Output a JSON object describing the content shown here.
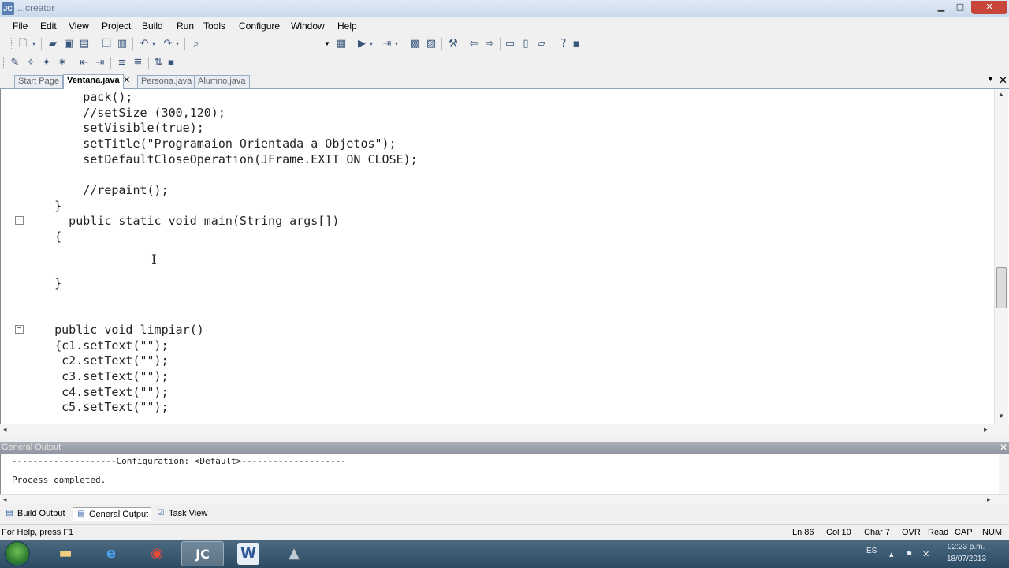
{
  "window": {
    "title": "...creator"
  },
  "menu": [
    "File",
    "Edit",
    "View",
    "Project",
    "Build",
    "Run",
    "Tools",
    "Configure",
    "Window",
    "Help"
  ],
  "editor_tabs": [
    {
      "label": "Start Page",
      "active": false
    },
    {
      "label": "Ventana.java",
      "active": true
    },
    {
      "label": "Persona.java",
      "active": false
    },
    {
      "label": "Alumno.java",
      "active": false
    }
  ],
  "code_lines": [
    "        pack();",
    "        //setSize (300,120);",
    "        setVisible(true);",
    "        setTitle(\"Programaion Orientada a Objetos\");",
    "        setDefaultCloseOperation(JFrame.EXIT_ON_CLOSE);",
    "",
    "        //repaint();",
    "    }",
    "      public static void main(String args[])",
    "    {",
    "",
    "",
    "    }",
    "",
    "",
    "    public void limpiar()",
    "    {c1.setText(\"\");",
    "     c2.setText(\"\");",
    "     c3.setText(\"\");",
    "     c4.setText(\"\");",
    "     c5.setText(\"\");"
  ],
  "output_panel": {
    "title": "General Output",
    "lines": [
      "--------------------Configuration: <Default>--------------------",
      "",
      "Process completed."
    ]
  },
  "bottom_tabs": [
    {
      "label": "Build Output",
      "active": false
    },
    {
      "label": "General Output",
      "active": true
    },
    {
      "label": "Task View",
      "active": false
    }
  ],
  "status": {
    "help": "For Help, press F1",
    "ln": "Ln 86",
    "col": "Col 10",
    "char": "Char 7",
    "ovr": "OVR",
    "read": "Read",
    "cap": "CAP",
    "num": "NUM"
  },
  "taskbar": {
    "lang": "ES",
    "time": "02:23 p.m.",
    "date": "18/07/2013",
    "apps": [
      "explorer",
      "internet-explorer",
      "chrome",
      "jcreator",
      "word",
      "other"
    ]
  },
  "colors": {
    "accent": "#5a7fb3",
    "close": "#c8453a",
    "taskbar": "#3a5a74"
  }
}
